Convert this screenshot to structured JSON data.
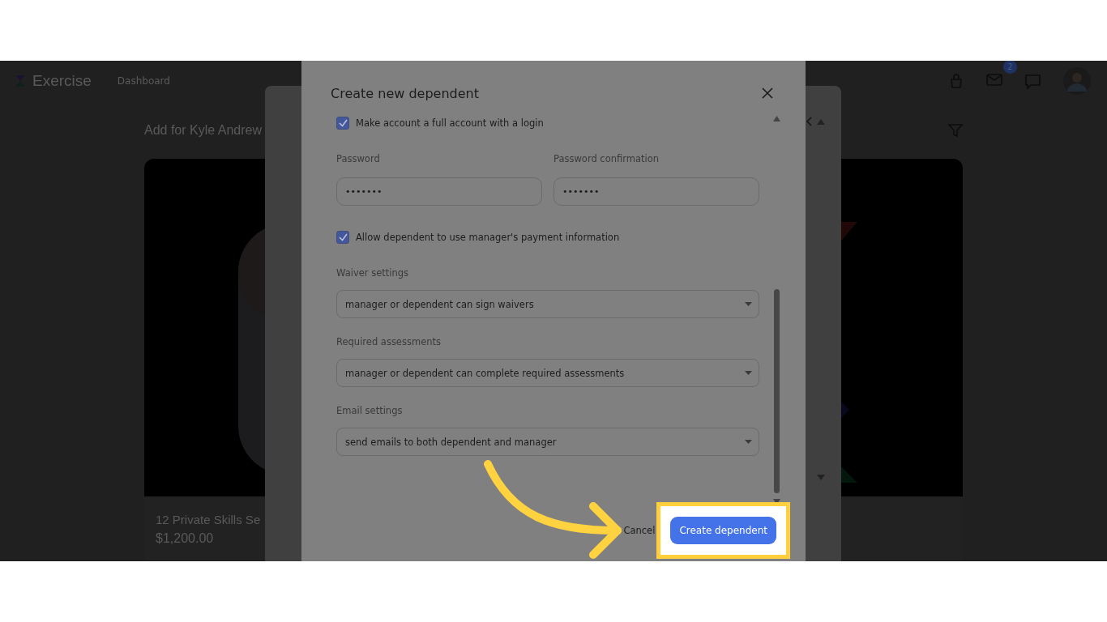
{
  "app": {
    "brand": "Exercise",
    "nav": [
      {
        "label": "Dashboard"
      }
    ],
    "mail_badge": "2",
    "page_title": "Add for Kyle Andrew",
    "card": {
      "title": "12 Private Skills Se",
      "price": "$1,200.00"
    }
  },
  "dialog": {
    "title": "Create new dependent",
    "fields": [
      {
        "kind": "checkbox",
        "label": "Make account a full account with a login",
        "checked": true
      },
      {
        "kind": "password_pair",
        "items": [
          {
            "label": "Password",
            "value": "•••••••"
          },
          {
            "label": "Password confirmation",
            "value": "•••••••"
          }
        ]
      },
      {
        "kind": "checkbox",
        "label": "Allow dependent to use manager's payment information",
        "checked": true
      },
      {
        "kind": "select",
        "label": "Waiver settings",
        "value": "manager or dependent can sign waivers"
      },
      {
        "kind": "select",
        "label": "Required assessments",
        "value": "manager or dependent can complete required assessments"
      },
      {
        "kind": "select",
        "label": "Email settings",
        "value": "send emails to both dependent and manager"
      }
    ],
    "cancel": "Cancel",
    "submit": "Create dependent"
  },
  "annotation": {
    "highlight_submit": true
  }
}
